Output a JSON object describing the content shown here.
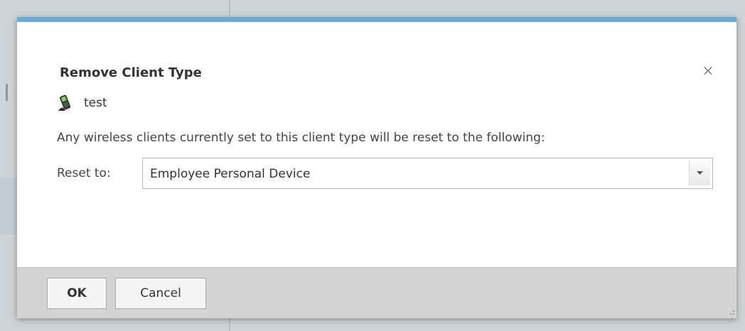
{
  "dialog": {
    "title": "Remove Client Type",
    "close_symbol": "×",
    "close_icon": "close-icon",
    "client": {
      "icon": "mobile-device-icon",
      "name": "test"
    },
    "message": "Any wireless clients currently set to this client type will be reset to the following:",
    "reset": {
      "label": "Reset to:",
      "selected": "Employee Personal Device"
    },
    "buttons": {
      "ok": "OK",
      "cancel": "Cancel"
    }
  },
  "colors": {
    "accent_bar": "#69acd7",
    "footer_bg": "#d4d4d4",
    "overlay_bg": "#cfd3d6"
  }
}
